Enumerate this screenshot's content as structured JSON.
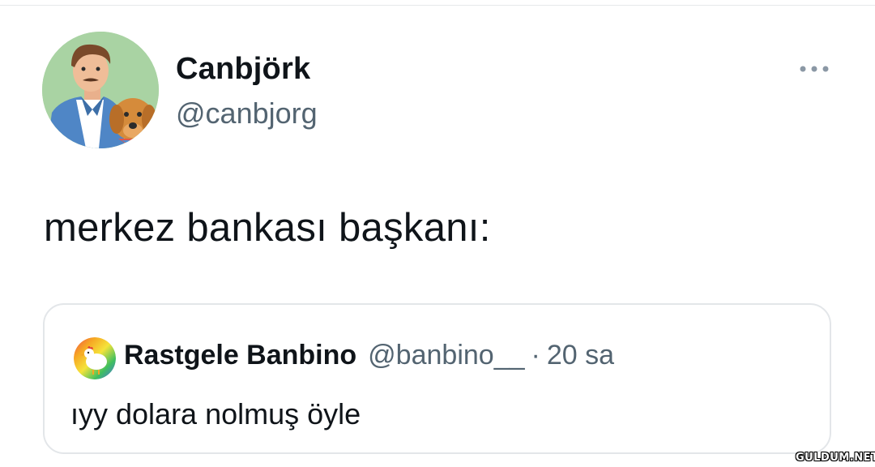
{
  "tweet": {
    "author": {
      "display_name": "Canbjörk",
      "handle": "@canbjorg",
      "avatar_icon": "profile-avatar-man-with-dog"
    },
    "more_icon": "more-horizontal-icon",
    "text": "merkez bankası başkanı:"
  },
  "quoted_tweet": {
    "display_name": "Rastgele Banbino",
    "handle": "@banbino__",
    "separator": "·",
    "time": "20 sa",
    "text": "ıyy dolara nolmuş öyle",
    "avatar_icon": "chicken-rainbow-avatar"
  },
  "watermark": "GULDUM.NET",
  "colors": {
    "primary_text": "#0f1419",
    "secondary_text": "#536471",
    "border": "#e3e6e9",
    "avatar_bg": "#a9d3a3"
  }
}
